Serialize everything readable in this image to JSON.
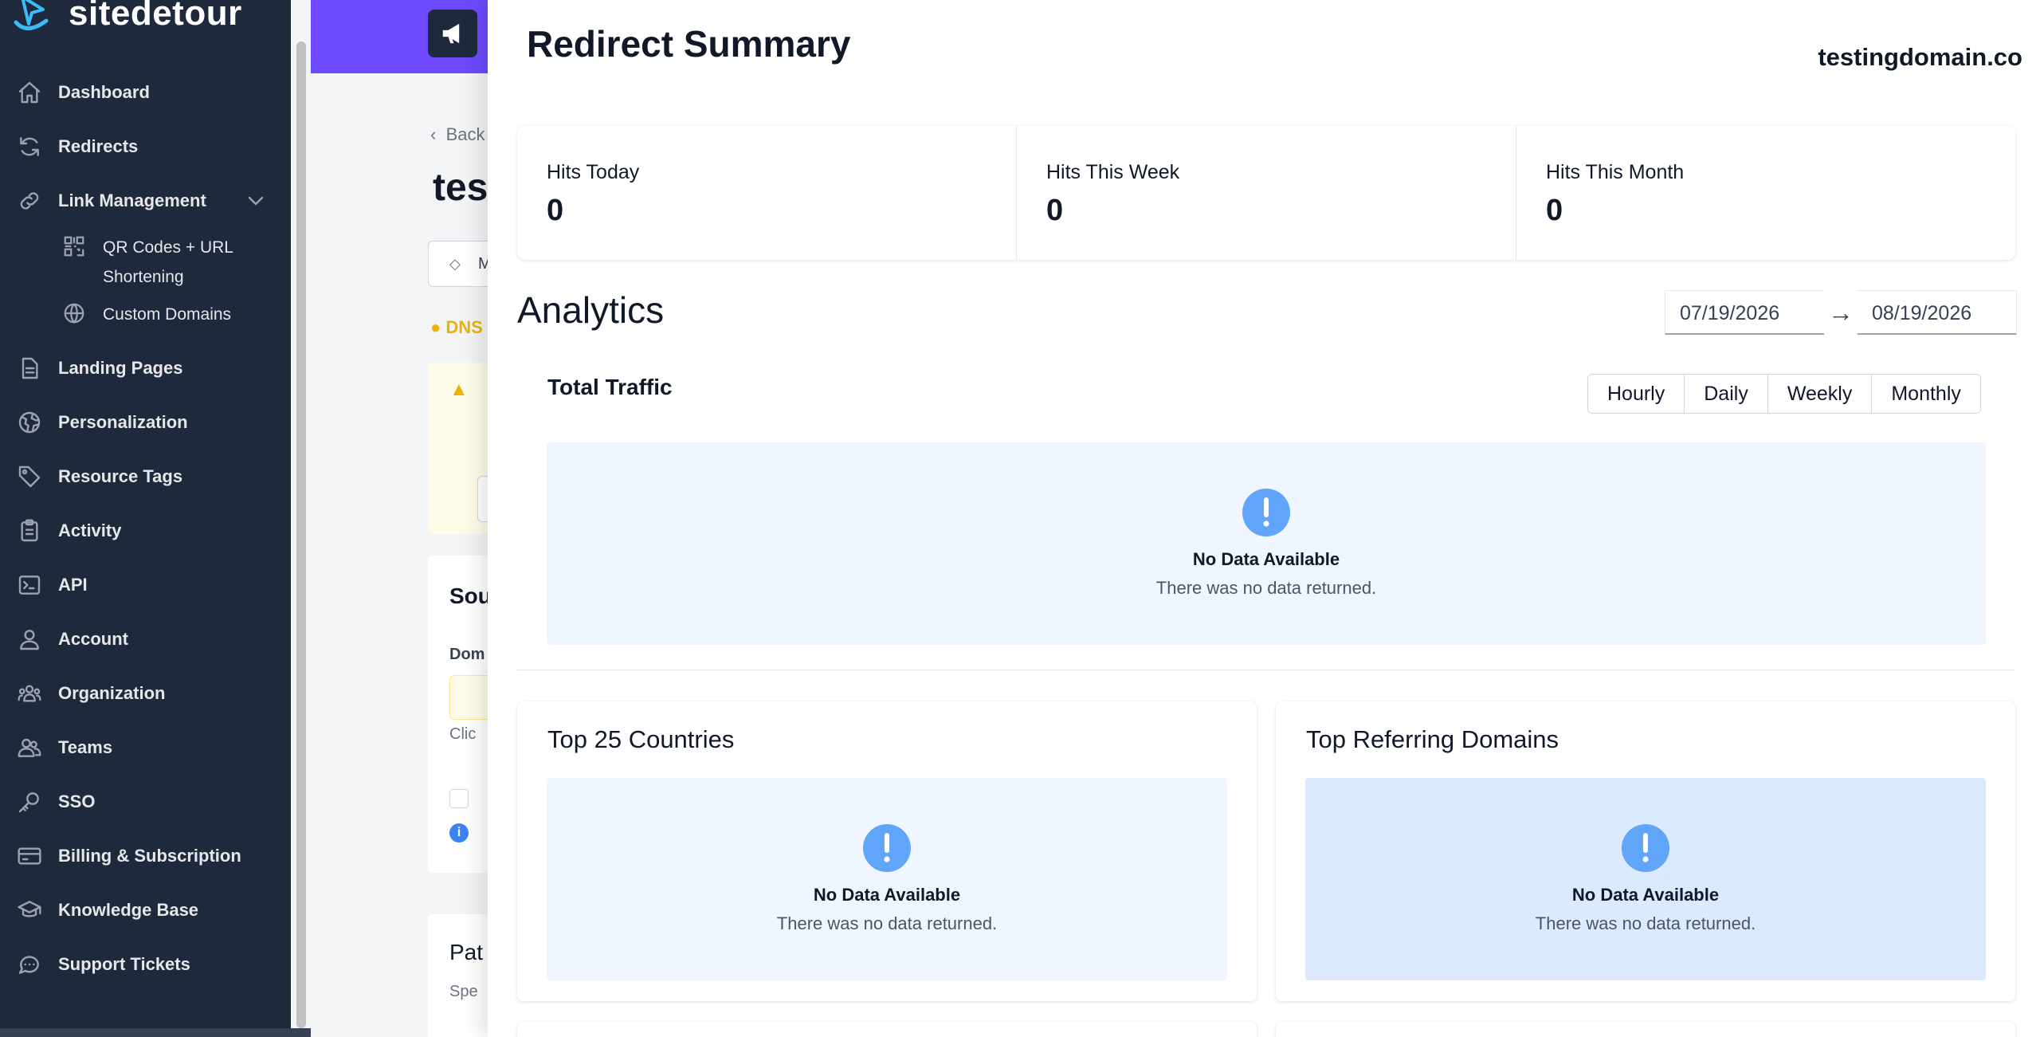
{
  "brand": {
    "name": "sitedetour",
    "accent": "#6d4aff"
  },
  "sidebar": {
    "items": [
      {
        "label": "Dashboard",
        "icon": "home-icon"
      },
      {
        "label": "Redirects",
        "icon": "refresh-icon"
      },
      {
        "label": "Link Management",
        "icon": "link-icon",
        "expanded": true
      },
      {
        "label": "QR Codes + URL Shortening",
        "icon": "qr-code-icon",
        "sub": true
      },
      {
        "label": "Custom Domains",
        "icon": "globe-icon",
        "sub": true
      },
      {
        "label": "Landing Pages",
        "icon": "document-icon"
      },
      {
        "label": "Personalization",
        "icon": "globe-alt-icon"
      },
      {
        "label": "Resource Tags",
        "icon": "tag-icon"
      },
      {
        "label": "Activity",
        "icon": "clipboard-icon"
      },
      {
        "label": "API",
        "icon": "terminal-icon"
      },
      {
        "label": "Account",
        "icon": "user-icon"
      },
      {
        "label": "Organization",
        "icon": "user-group-icon"
      },
      {
        "label": "Teams",
        "icon": "users-icon"
      },
      {
        "label": "SSO",
        "icon": "key-icon"
      },
      {
        "label": "Billing & Subscription",
        "icon": "credit-card-icon"
      },
      {
        "label": "Knowledge Base",
        "icon": "academic-cap-icon"
      },
      {
        "label": "Support Tickets",
        "icon": "chat-icon"
      }
    ],
    "qr_line1": "QR Codes + URL",
    "qr_line2": "Shortening"
  },
  "background": {
    "back": "Back",
    "title": "tes",
    "tag": "M",
    "dns": "DNS",
    "card_title": "Sou",
    "card_sub": "Dom",
    "card_click": "Clic",
    "card2_title": "Pat",
    "card2_sub": "Spe"
  },
  "modal": {
    "title": "Redirect Summary",
    "domain": "testingdomain.co",
    "stats": [
      {
        "label": "Hits Today",
        "value": "0"
      },
      {
        "label": "Hits This Week",
        "value": "0"
      },
      {
        "label": "Hits This Month",
        "value": "0"
      }
    ],
    "analytics_title": "Analytics",
    "date_start": "07/19/2026",
    "date_end": "08/19/2026",
    "date_arrow": "→",
    "traffic_title": "Total Traffic",
    "granularity": [
      "Hourly",
      "Daily",
      "Weekly",
      "Monthly"
    ],
    "empty_title": "No Data Available",
    "empty_sub": "There was no data returned.",
    "countries_title": "Top 25 Countries",
    "referrers_title": "Top Referring Domains"
  }
}
